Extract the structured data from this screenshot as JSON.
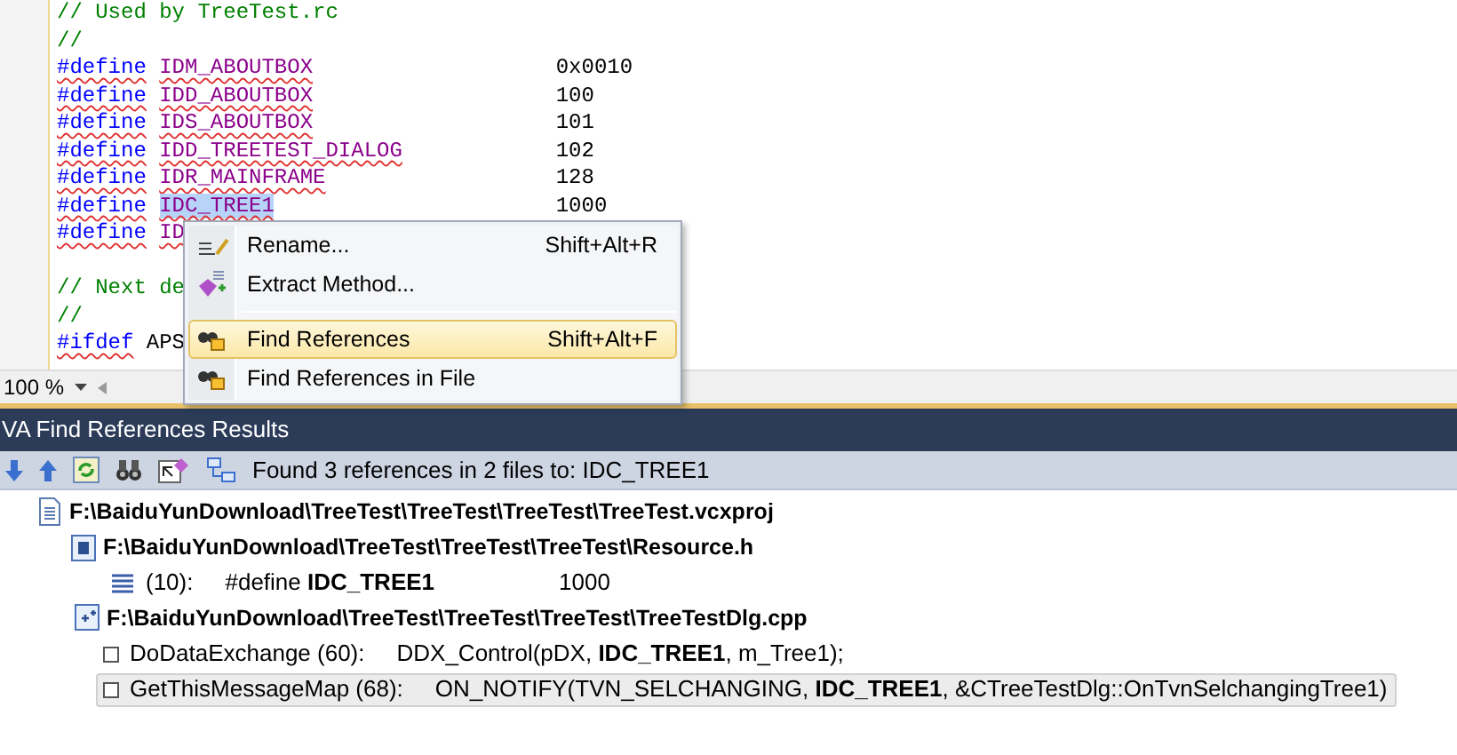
{
  "editor": {
    "lines": [
      {
        "kind": "comment",
        "text": "// Used by TreeTest.rc"
      },
      {
        "kind": "comment",
        "text": "//"
      },
      {
        "kind": "define",
        "keyword": "#define",
        "name": "IDM_ABOUTBOX",
        "value": "0x0010",
        "selected": false
      },
      {
        "kind": "define",
        "keyword": "#define",
        "name": "IDD_ABOUTBOX",
        "value": "100",
        "selected": false
      },
      {
        "kind": "define",
        "keyword": "#define",
        "name": "IDS_ABOUTBOX",
        "value": "101",
        "selected": false
      },
      {
        "kind": "define",
        "keyword": "#define",
        "name": "IDD_TREETEST_DIALOG",
        "value": "102",
        "selected": false
      },
      {
        "kind": "define",
        "keyword": "#define",
        "name": "IDR_MAINFRAME",
        "value": "128",
        "selected": false
      },
      {
        "kind": "define",
        "keyword": "#define",
        "name": "IDC_TREE1",
        "value": "1000",
        "selected": true
      },
      {
        "kind": "define",
        "keyword": "#define",
        "name": "ID",
        "selected": false
      },
      {
        "kind": "blank"
      },
      {
        "kind": "comment",
        "text": "// Next de"
      },
      {
        "kind": "comment",
        "text": "//"
      },
      {
        "kind": "ifdef",
        "keyword": "#ifdef",
        "name": "APS"
      }
    ]
  },
  "zoom": {
    "value": "100 %"
  },
  "context_menu": {
    "items": [
      {
        "kind": "item",
        "label": "Rename...",
        "shortcut": "Shift+Alt+R",
        "selected": false
      },
      {
        "kind": "item",
        "label": "Extract Method...",
        "selected": false
      },
      {
        "kind": "separator"
      },
      {
        "kind": "item",
        "label": "Find References",
        "shortcut": "Shift+Alt+F",
        "selected": true
      },
      {
        "kind": "item",
        "label": "Find References in File",
        "selected": false
      }
    ]
  },
  "results_panel": {
    "title": "VA Find References Results",
    "summary": "Found 3 references in 2 files to: IDC_TREE1",
    "tree": [
      {
        "kind": "project",
        "path": "F:\\BaiduYunDownload\\TreeTest\\TreeTest\\TreeTest\\TreeTest.vcxproj",
        "children": [
          {
            "kind": "header",
            "path": "F:\\BaiduYunDownload\\TreeTest\\TreeTest\\TreeTest\\Resource.h",
            "children": [
              {
                "kind": "define",
                "location": "(10):",
                "code": "#define **IDC_TREE1**",
                "value": "1000",
                "selected": false
              }
            ]
          },
          {
            "kind": "source",
            "path": "F:\\BaiduYunDownload\\TreeTest\\TreeTest\\TreeTest\\TreeTestDlg.cpp",
            "children": [
              {
                "kind": "function",
                "location": "DoDataExchange (60):",
                "code": "DDX_Control(pDX, **IDC_TREE1**, m_Tree1);",
                "selected": false
              },
              {
                "kind": "function",
                "location": "GetThisMessageMap (68):",
                "code": "ON_NOTIFY(TVN_SELCHANGING, **IDC_TREE1**, &CTreeTestDlg::OnTvnSelchangingTree1)",
                "selected": true
              }
            ]
          }
        ]
      }
    ]
  }
}
